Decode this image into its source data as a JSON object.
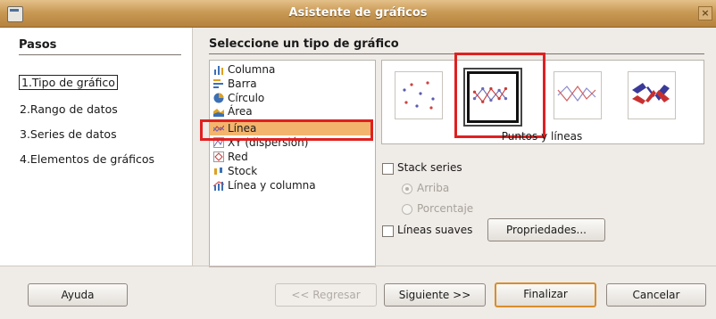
{
  "window": {
    "title": "Asistente de gráficos"
  },
  "steps": {
    "heading": "Pasos",
    "items": [
      {
        "label": "1.Tipo de gráfico"
      },
      {
        "label": "2.Rango de datos"
      },
      {
        "label": "3.Series de datos"
      },
      {
        "label": "4.Elementos de gráficos"
      }
    ]
  },
  "main": {
    "heading": "Seleccione un tipo de gráfico",
    "chart_types": [
      {
        "label": "Columna",
        "icon": "column-chart-icon"
      },
      {
        "label": "Barra",
        "icon": "bar-chart-icon"
      },
      {
        "label": "Círculo",
        "icon": "pie-chart-icon"
      },
      {
        "label": "Área",
        "icon": "area-chart-icon"
      },
      {
        "label": "Línea",
        "icon": "line-chart-icon",
        "selected": true
      },
      {
        "label": "XY (dispersión)",
        "icon": "xy-scatter-chart-icon"
      },
      {
        "label": "Red",
        "icon": "net-chart-icon"
      },
      {
        "label": "Stock",
        "icon": "stock-chart-icon"
      },
      {
        "label": "Línea y columna",
        "icon": "line-column-chart-icon"
      }
    ],
    "subtypes": [
      {
        "icon": "points-only-icon"
      },
      {
        "icon": "points-and-lines-icon",
        "selected": true
      },
      {
        "icon": "lines-only-icon"
      },
      {
        "icon": "3d-lines-icon"
      }
    ],
    "subtype_label": "Puntos y líneas"
  },
  "options": {
    "stack_series": {
      "label": "Stack series",
      "checked": false
    },
    "stack_top": {
      "label": "Arriba",
      "selected": true,
      "enabled": false
    },
    "stack_percent": {
      "label": "Porcentaje",
      "selected": false,
      "enabled": false
    },
    "smooth_lines": {
      "label": "Líneas suaves",
      "checked": false
    },
    "properties_button": "Propriedades..."
  },
  "buttons": {
    "help": "Ayuda",
    "back": "<< Regresar",
    "next": "Siguiente >>",
    "finish": "Finalizar",
    "cancel": "Cancelar"
  },
  "colors": {
    "selection": "#f3b56d",
    "title_bar": "#c99a55",
    "highlight": "#e02020"
  }
}
